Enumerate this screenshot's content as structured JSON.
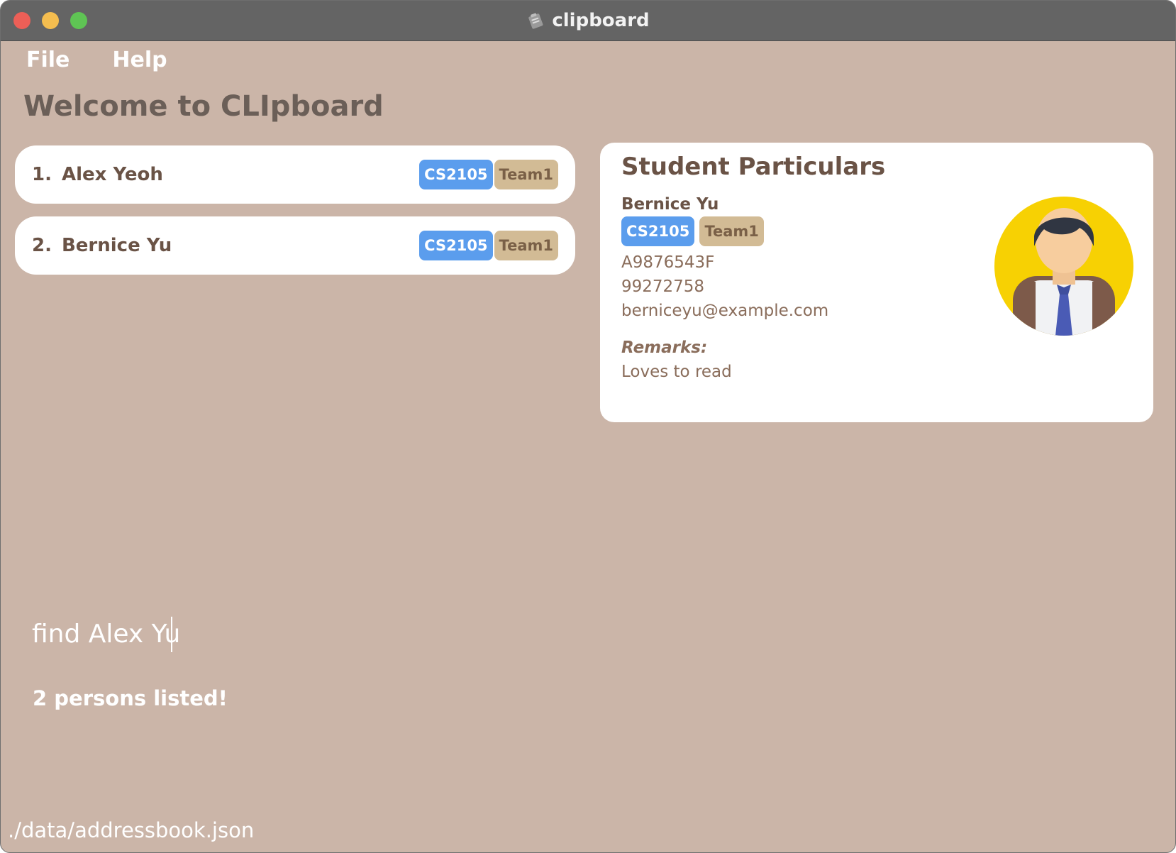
{
  "window": {
    "title": "clipboard"
  },
  "menu": {
    "items": [
      "File",
      "Help"
    ]
  },
  "page": {
    "title": "Welcome to CLIpboard"
  },
  "persons": [
    {
      "index": "1.",
      "name": "Alex Yeoh",
      "tags": [
        "CS2105",
        "Team1"
      ]
    },
    {
      "index": "2.",
      "name": "Bernice Yu",
      "tags": [
        "CS2105",
        "Team1"
      ]
    }
  ],
  "details": {
    "heading": "Student Particulars",
    "name": "Bernice Yu",
    "tags": [
      "CS2105",
      "Team1"
    ],
    "student_id": "A9876543F",
    "phone": "99272758",
    "email": "berniceyu@example.com",
    "remarks_label": "Remarks:",
    "remarks": "Loves to read"
  },
  "command": {
    "value": "find Alex Yu"
  },
  "result": {
    "message": "2 persons listed!"
  },
  "status": {
    "file_path": "./data/addressbook.json"
  },
  "colors": {
    "background": "#cbb5a8",
    "module_tag": "#5b9ded",
    "team_tag": "#d2bb95",
    "avatar_bg": "#f7d103"
  }
}
